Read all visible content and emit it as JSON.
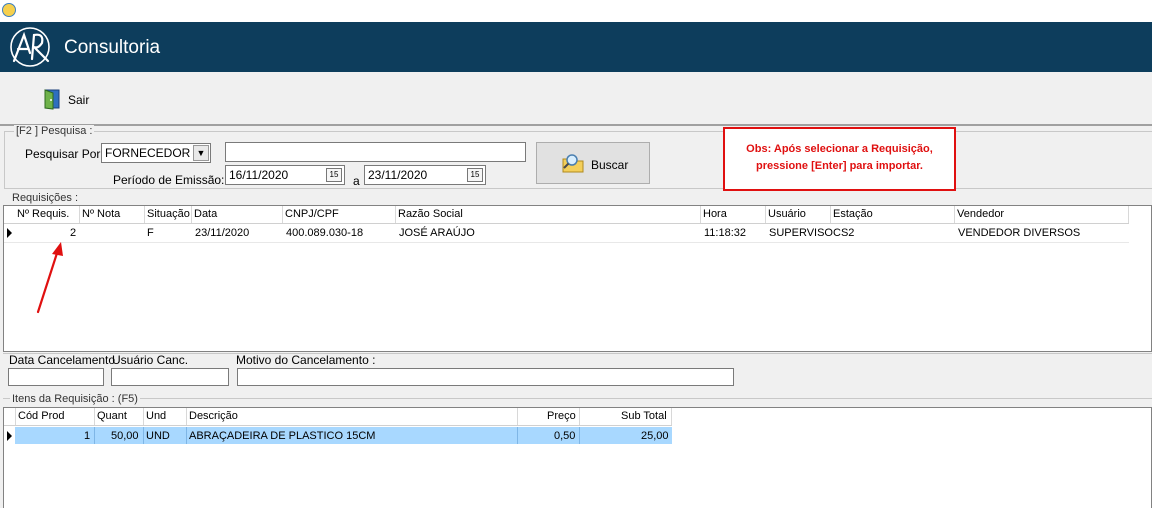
{
  "app": {
    "brand": "Consultoria",
    "logo_text": "AR"
  },
  "toolbar": {
    "exit_label": "Sair"
  },
  "search": {
    "group_label": "[F2 ]  Pesquisa :",
    "search_by_label": "Pesquisar Por:",
    "search_by_value": "FORNECEDOR",
    "search_text": "",
    "period_label": "Período de Emissão:",
    "date_from": "16/11/2020",
    "date_to": "23/11/2020",
    "date_sep": "a",
    "calendar_glyph": "15",
    "search_button": "Buscar"
  },
  "note": {
    "line1": "Obs: Após selecionar a Requisição,",
    "line2": "pressione [Enter] para importar."
  },
  "requisitions": {
    "label": "Requisições :",
    "columns": [
      "Nº Requis.",
      "Nº Nota",
      "Situação",
      "Data",
      "CNPJ/CPF",
      "Razão Social",
      "Hora",
      "Usuário",
      "Estação",
      "Vendedor"
    ],
    "rows": [
      {
        "requis": "2",
        "nota": "",
        "situacao": "F",
        "data": "23/11/2020",
        "cnpj": "400.089.030-18",
        "razao": "JOSÉ ARAÚJO",
        "hora": "11:18:32",
        "usuario": "SUPERVISO",
        "estacao": "CS2",
        "vendedor": "VENDEDOR DIVERSOS"
      }
    ]
  },
  "cancel": {
    "date_label": "Data Cancelamento",
    "user_label": "Usuário Canc.",
    "reason_label": "Motivo do Cancelamento  :",
    "date_value": "",
    "user_value": "",
    "reason_value": ""
  },
  "items": {
    "label": "Itens da Requisição : (F5)",
    "columns": [
      "Cód Prod",
      "Quant",
      "Und",
      "Descrição",
      "Preço",
      "Sub Total"
    ],
    "rows": [
      {
        "cod": "1",
        "quant": "50,00",
        "und": "UND",
        "descricao": "ABRAÇADEIRA DE PLASTICO 15CM",
        "preco": "0,50",
        "subtotal": "25,00"
      }
    ]
  },
  "colors": {
    "header_bg": "#0d3d5c",
    "note_red": "#e01010",
    "selected_row": "#a8d8ff",
    "arrow_red": "#e01010"
  }
}
